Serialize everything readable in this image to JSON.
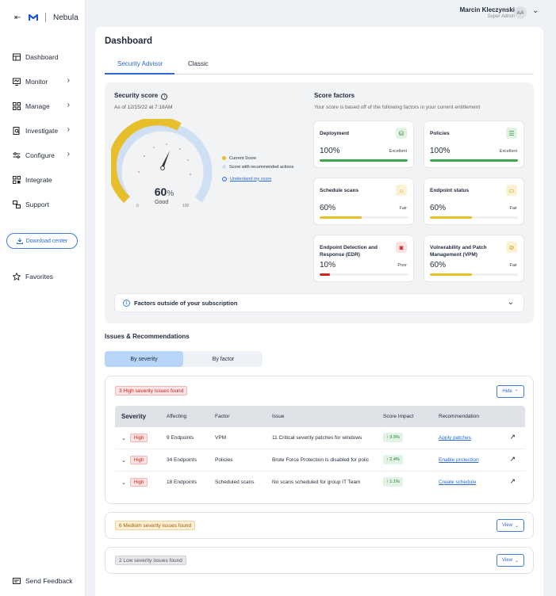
{
  "brand": {
    "name": "Nebula"
  },
  "nav": {
    "items": [
      {
        "label": "Dashboard"
      },
      {
        "label": "Monitor"
      },
      {
        "label": "Manage"
      },
      {
        "label": "Investigate"
      },
      {
        "label": "Configure"
      },
      {
        "label": "Integrate"
      },
      {
        "label": "Support"
      }
    ],
    "download": "Download center",
    "favorites": "Favorites",
    "feedback": "Send Feedback"
  },
  "user": {
    "name": "Marcin Kleczynski",
    "role": "Super Admin",
    "initials": "AA"
  },
  "page": {
    "title": "Dashboard",
    "tabs": [
      "Security Advisor",
      "Classic"
    ]
  },
  "score": {
    "title": "Security score",
    "date": "As of 12/15/22 at 7:18AM",
    "value": "60",
    "percent_sign": "%",
    "label": "Good",
    "min": "0",
    "max": "100",
    "legend": {
      "current": "Current Score",
      "recommended": "Score with recommended actions",
      "link": "Understand my score"
    },
    "colors": {
      "current": "#e6bf2a",
      "recommended": "#cfe0f5"
    }
  },
  "factors": {
    "title": "Score factors",
    "subtitle": "Your score is based off of the following factors in your current entitlement",
    "items": [
      {
        "name": "Deployment",
        "value": "100%",
        "rating": "Excellent",
        "fill": 1.0,
        "color": "#3aa84a"
      },
      {
        "name": "Policies",
        "value": "100%",
        "rating": "Excellent",
        "fill": 1.0,
        "color": "#3aa84a"
      },
      {
        "name": "Schedule scans",
        "value": "60%",
        "rating": "Fair",
        "fill": 0.48,
        "color": "#e6bf2a"
      },
      {
        "name": "Endpoint status",
        "value": "60%",
        "rating": "Fair",
        "fill": 0.48,
        "color": "#e6bf2a"
      },
      {
        "name": "Endpoint Detection and Response (EDR)",
        "value": "10%",
        "rating": "Poor",
        "fill": 0.12,
        "color": "#d32020"
      },
      {
        "name": "Vulnerability and Patch Management (VPM)",
        "value": "60%",
        "rating": "Fair",
        "fill": 0.48,
        "color": "#e6bf2a"
      }
    ],
    "outside": {
      "count": "1",
      "label": "Factors outside of your subscription"
    }
  },
  "issues": {
    "title": "Issues & Recommendations",
    "segments": [
      "By severity",
      "By factor"
    ],
    "high": {
      "badge": "3 High severity issues found",
      "button": "Hide",
      "headers": [
        "Severity",
        "Affecting",
        "Factor",
        "Issue",
        "Score Impact",
        "Recommendation"
      ],
      "rows": [
        {
          "severity": "High",
          "affecting": "9 Endpoints",
          "factor": "VPM",
          "issue": "11 Critical severity patches for windows",
          "impact": "↑ 3.9%",
          "rec": "Apply patches"
        },
        {
          "severity": "High",
          "affecting": "34 Endpoints",
          "factor": "Policies",
          "issue": "Brute Force Protection is disabled for polic",
          "impact": "↑ 2.4%",
          "rec": "Enable protection"
        },
        {
          "severity": "High",
          "affecting": "18 Endpoints",
          "factor": "Scheduled scans",
          "issue": "No scans scheduled for group IT Team",
          "impact": "↑ 1.1%",
          "rec": "Create schedule"
        }
      ]
    },
    "medium": {
      "badge": "6 Medium severity issues found",
      "button": "View"
    },
    "low": {
      "badge": "2 Low severity issues found",
      "button": "View"
    }
  }
}
